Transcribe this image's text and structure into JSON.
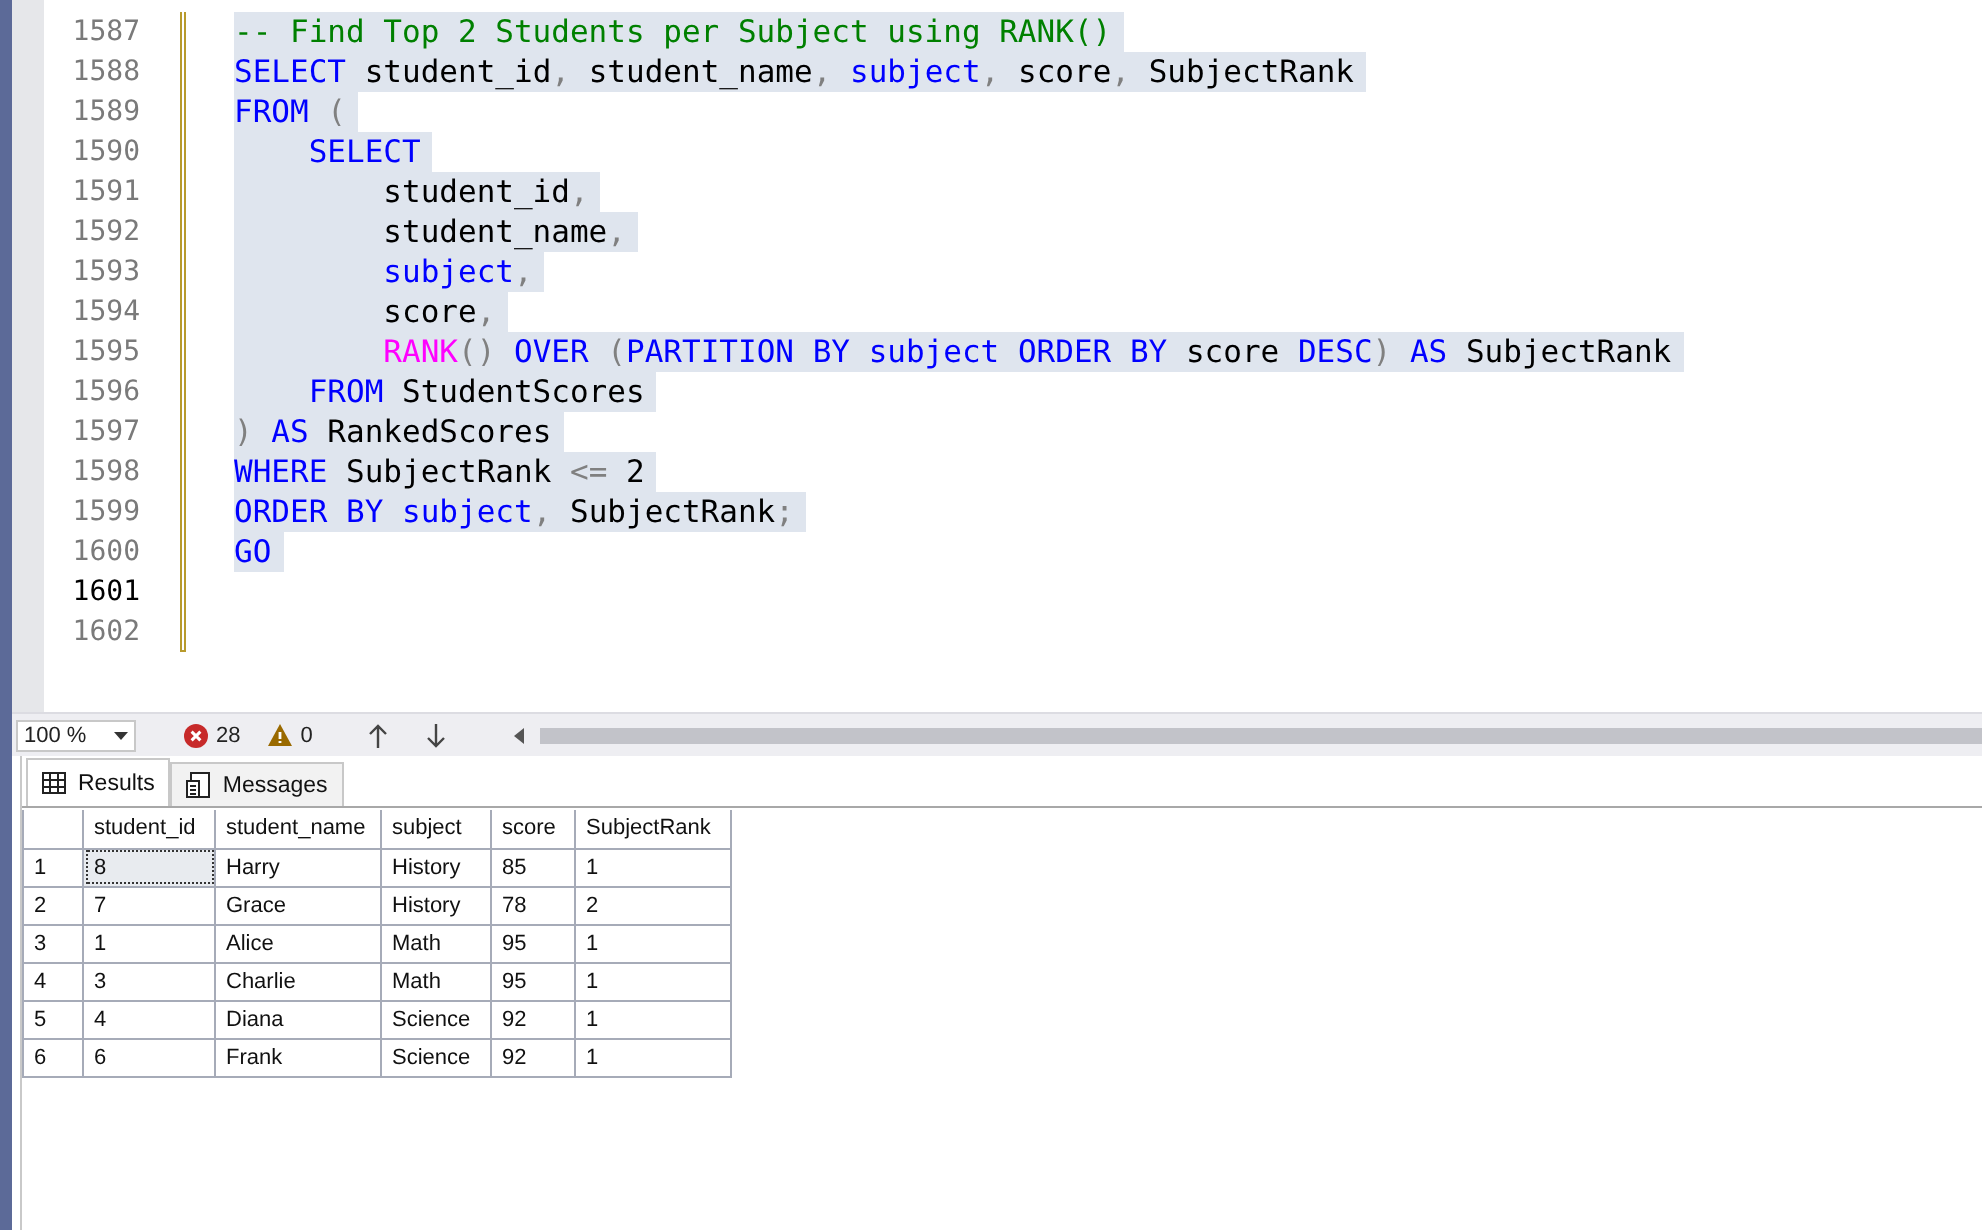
{
  "editor": {
    "lines": [
      {
        "number": "1587",
        "current": false,
        "selected": true,
        "tokens": [
          {
            "text": "-- Find Top 2 Students per Subject using RANK()",
            "kind": "comment"
          }
        ]
      },
      {
        "number": "1588",
        "current": false,
        "selected": true,
        "tokens": [
          {
            "text": "SELECT",
            "kind": "keyword"
          },
          {
            "text": " student_id",
            "kind": "plain"
          },
          {
            "text": ",",
            "kind": "operator"
          },
          {
            "text": " student_name",
            "kind": "plain"
          },
          {
            "text": ",",
            "kind": "operator"
          },
          {
            "text": " subject",
            "kind": "keyword"
          },
          {
            "text": ",",
            "kind": "operator"
          },
          {
            "text": " score",
            "kind": "plain"
          },
          {
            "text": ",",
            "kind": "operator"
          },
          {
            "text": " SubjectRank",
            "kind": "plain"
          }
        ]
      },
      {
        "number": "1589",
        "current": false,
        "selected": true,
        "tokens": [
          {
            "text": "FROM",
            "kind": "keyword"
          },
          {
            "text": " (",
            "kind": "operator"
          }
        ]
      },
      {
        "number": "1590",
        "current": false,
        "selected": true,
        "tokens": [
          {
            "text": "    SELECT",
            "kind": "keyword"
          }
        ]
      },
      {
        "number": "1591",
        "current": false,
        "selected": true,
        "tokens": [
          {
            "text": "        student_id",
            "kind": "plain"
          },
          {
            "text": ",",
            "kind": "operator"
          }
        ]
      },
      {
        "number": "1592",
        "current": false,
        "selected": true,
        "tokens": [
          {
            "text": "        student_name",
            "kind": "plain"
          },
          {
            "text": ",",
            "kind": "operator"
          }
        ]
      },
      {
        "number": "1593",
        "current": false,
        "selected": true,
        "tokens": [
          {
            "text": "        subject",
            "kind": "keyword"
          },
          {
            "text": ",",
            "kind": "operator"
          }
        ]
      },
      {
        "number": "1594",
        "current": false,
        "selected": true,
        "tokens": [
          {
            "text": "        score",
            "kind": "plain"
          },
          {
            "text": ",",
            "kind": "operator"
          }
        ]
      },
      {
        "number": "1595",
        "current": false,
        "selected": true,
        "tokens": [
          {
            "text": "        RANK",
            "kind": "function"
          },
          {
            "text": "()",
            "kind": "operator"
          },
          {
            "text": " OVER",
            "kind": "keyword"
          },
          {
            "text": " (",
            "kind": "operator"
          },
          {
            "text": "PARTITION BY subject ORDER BY",
            "kind": "keyword"
          },
          {
            "text": " score",
            "kind": "plain"
          },
          {
            "text": " DESC",
            "kind": "keyword"
          },
          {
            "text": ")",
            "kind": "operator"
          },
          {
            "text": " AS",
            "kind": "keyword"
          },
          {
            "text": " SubjectRank",
            "kind": "plain"
          }
        ]
      },
      {
        "number": "1596",
        "current": false,
        "selected": true,
        "tokens": [
          {
            "text": "    FROM",
            "kind": "keyword"
          },
          {
            "text": " StudentScores",
            "kind": "plain"
          }
        ]
      },
      {
        "number": "1597",
        "current": false,
        "selected": true,
        "tokens": [
          {
            "text": ")",
            "kind": "operator"
          },
          {
            "text": " AS",
            "kind": "keyword"
          },
          {
            "text": " RankedScores",
            "kind": "plain"
          }
        ]
      },
      {
        "number": "1598",
        "current": false,
        "selected": true,
        "tokens": [
          {
            "text": "WHERE",
            "kind": "keyword"
          },
          {
            "text": " SubjectRank",
            "kind": "plain"
          },
          {
            "text": " <=",
            "kind": "operator"
          },
          {
            "text": " 2",
            "kind": "plain"
          }
        ]
      },
      {
        "number": "1599",
        "current": false,
        "selected": true,
        "tokens": [
          {
            "text": "ORDER BY",
            "kind": "keyword"
          },
          {
            "text": " subject",
            "kind": "keyword"
          },
          {
            "text": ",",
            "kind": "operator"
          },
          {
            "text": " SubjectRank",
            "kind": "plain"
          },
          {
            "text": ";",
            "kind": "operator"
          }
        ]
      },
      {
        "number": "1600",
        "current": false,
        "selected": true,
        "tokens": [
          {
            "text": "GO",
            "kind": "keyword"
          }
        ]
      },
      {
        "number": "1601",
        "current": true
      },
      {
        "number": "1602",
        "current": false
      }
    ]
  },
  "status_bar": {
    "zoom": "100 %",
    "errors": "28",
    "warnings": "0"
  },
  "tabs": [
    {
      "label": "Results",
      "selected": true
    },
    {
      "label": "Messages",
      "selected": false
    }
  ],
  "table": {
    "columns": [
      "student_id",
      "student_name",
      "subject",
      "score",
      "SubjectRank"
    ],
    "rows": [
      {
        "number": "1",
        "cells": [
          {
            "text": "8",
            "focused": true
          },
          {
            "text": "Harry",
            "focused": false
          },
          {
            "text": "History",
            "focused": false
          },
          {
            "text": "85",
            "focused": false
          },
          {
            "text": "1",
            "focused": false
          }
        ]
      },
      {
        "number": "2",
        "cells": [
          {
            "text": "7",
            "focused": false
          },
          {
            "text": "Grace",
            "focused": false
          },
          {
            "text": "History",
            "focused": false
          },
          {
            "text": "78",
            "focused": false
          },
          {
            "text": "2",
            "focused": false
          }
        ]
      },
      {
        "number": "3",
        "cells": [
          {
            "text": "1",
            "focused": false
          },
          {
            "text": "Alice",
            "focused": false
          },
          {
            "text": "Math",
            "focused": false
          },
          {
            "text": "95",
            "focused": false
          },
          {
            "text": "1",
            "focused": false
          }
        ]
      },
      {
        "number": "4",
        "cells": [
          {
            "text": "3",
            "focused": false
          },
          {
            "text": "Charlie",
            "focused": false
          },
          {
            "text": "Math",
            "focused": false
          },
          {
            "text": "95",
            "focused": false
          },
          {
            "text": "1",
            "focused": false
          }
        ]
      },
      {
        "number": "5",
        "cells": [
          {
            "text": "4",
            "focused": false
          },
          {
            "text": "Diana",
            "focused": false
          },
          {
            "text": "Science",
            "focused": false
          },
          {
            "text": "92",
            "focused": false
          },
          {
            "text": "1",
            "focused": false
          }
        ]
      },
      {
        "number": "6",
        "cells": [
          {
            "text": "6",
            "focused": false
          },
          {
            "text": "Frank",
            "focused": false
          },
          {
            "text": "Science",
            "focused": false
          },
          {
            "text": "92",
            "focused": false
          },
          {
            "text": "1",
            "focused": false
          }
        ]
      }
    ]
  }
}
